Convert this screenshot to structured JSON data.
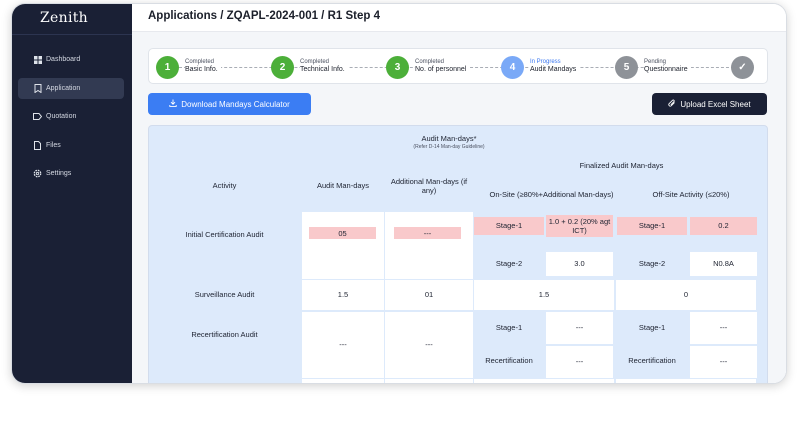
{
  "sidebar": {
    "brand": "Zenith",
    "items": [
      {
        "label": "Dashboard",
        "icon": "dashboard-icon",
        "active": false
      },
      {
        "label": "Application",
        "icon": "bookmark-icon",
        "active": true
      },
      {
        "label": "Quotation",
        "icon": "tag-icon",
        "active": false
      },
      {
        "label": "Files",
        "icon": "file-icon",
        "active": false
      },
      {
        "label": "Settings",
        "icon": "gear-icon",
        "active": false
      }
    ]
  },
  "header": {
    "title": "Applications / ZQAPL-2024-001 / R1 Step 4"
  },
  "stepper": {
    "steps": [
      {
        "number": "1",
        "status": "Completed",
        "label": "Basic Info."
      },
      {
        "number": "2",
        "status": "Completed",
        "label": "Technical Info."
      },
      {
        "number": "3",
        "status": "Completed",
        "label": "No. of personnel"
      },
      {
        "number": "4",
        "status": "In Progress",
        "label": "Audit Mandays"
      },
      {
        "number": "5",
        "status": "Pending",
        "label": "Questionnaire"
      },
      {
        "number": "✓",
        "status": "",
        "label": ""
      }
    ]
  },
  "buttons": {
    "download": "Download Mandays Calculator",
    "upload": "Upload Excel Sheet"
  },
  "table": {
    "title": "Audit Man-days*",
    "subtitle": "(Refer D-14 Man-day Guideline)",
    "headers": {
      "activity": "Activity",
      "audit_mandays": "Audit Man-days",
      "additional": "Additional Man-days (if any)",
      "finalized": "Finalized Audit Man-days",
      "onsite": "On-Site (≥80%+Additional Man-days)",
      "offsite": "Off-Site Activity (≤20%)"
    },
    "rows": {
      "initial": {
        "activity": "Initial Certification Audit",
        "audit_mandays": "05",
        "additional": "---",
        "onsite_stage1_label": "Stage-1",
        "onsite_stage1_value": "1.0 + 0.2 (20% agt ICT)",
        "offsite_stage1_label": "Stage-1",
        "offsite_stage1_value": "0.2",
        "onsite_stage2_label": "Stage-2",
        "onsite_stage2_value": "3.0",
        "offsite_stage2_label": "Stage-2",
        "offsite_stage2_value": "N0.8A"
      },
      "surveillance": {
        "activity": "Surveillance Audit",
        "audit_mandays": "1.5",
        "additional": "01",
        "onsite": "1.5",
        "offsite": "0"
      },
      "recertification": {
        "activity": "Recertification Audit",
        "audit_mandays": "---",
        "additional": "---",
        "onsite_stage1_label": "Stage-1",
        "onsite_stage1_value": "---",
        "offsite_stage1_label": "Stage-1",
        "offsite_stage1_value": "---",
        "onsite_recert_label": "Recertification",
        "onsite_recert_value": "---",
        "offsite_recert_label": "Recertification",
        "offsite_recert_value": "---"
      }
    }
  }
}
